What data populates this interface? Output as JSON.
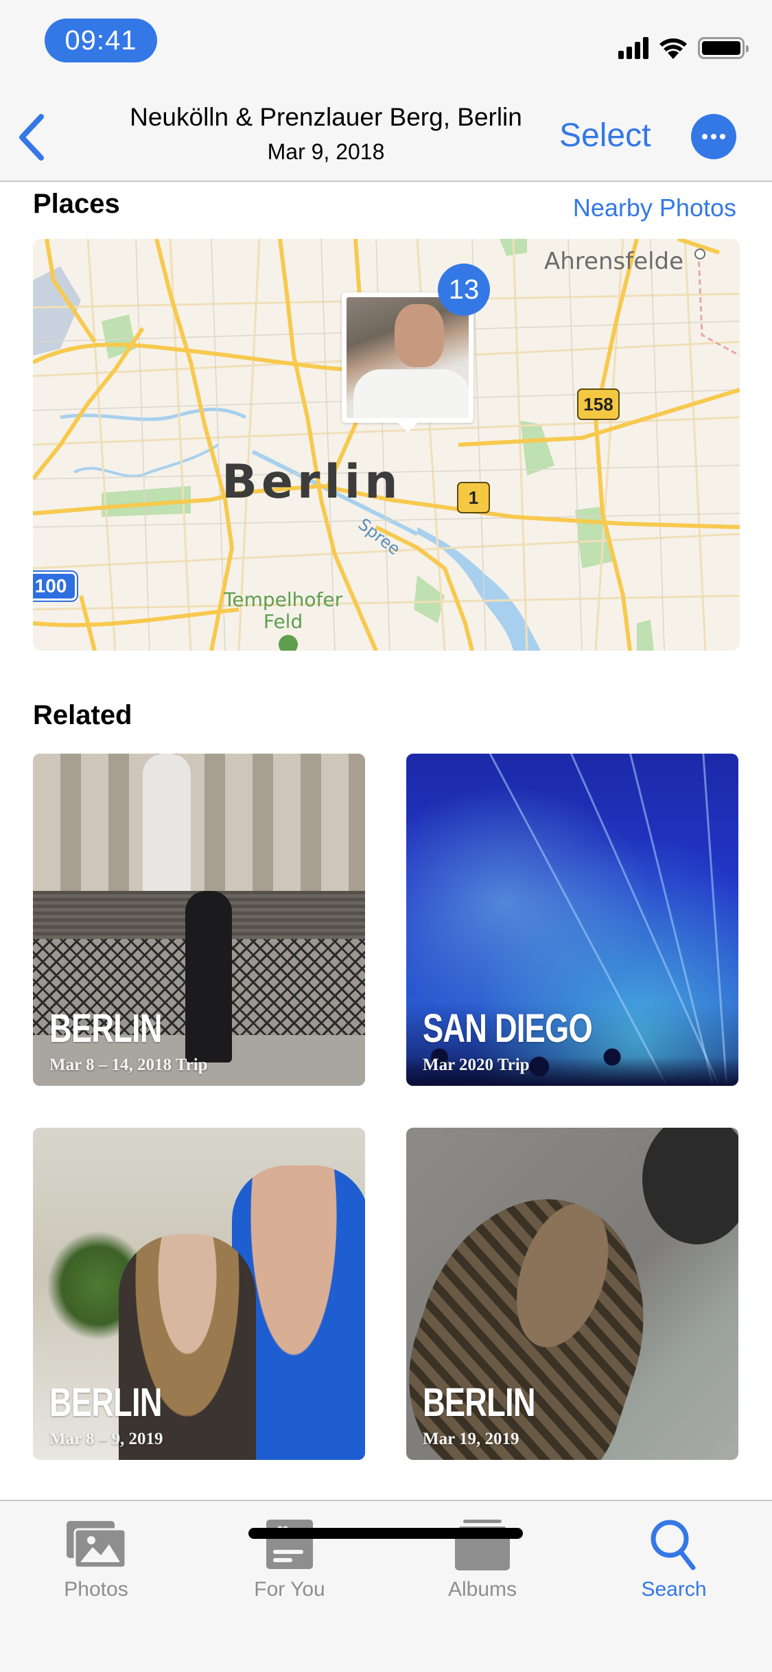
{
  "status_bar": {
    "time": "09:41",
    "icons": [
      "cellular-signal-icon",
      "wifi-icon",
      "battery-icon"
    ]
  },
  "nav": {
    "back_icon": "chevron-left-icon",
    "title": "Neukölln & Prenzlauer Berg, Berlin",
    "subtitle": "Mar 9, 2018",
    "select_label": "Select",
    "more_icon": "ellipsis-circle-icon"
  },
  "places": {
    "title": "Places",
    "nearby_label": "Nearby Photos",
    "map": {
      "city_label": "Berlin",
      "district_label": "Ahrensfelde",
      "park_label_line1": "Tempelhofer",
      "park_label_line2": "Feld",
      "river_label": "Spree",
      "road_shields": [
        "158",
        "1",
        "100"
      ],
      "photo_count": "13"
    }
  },
  "related": {
    "title": "Related",
    "cards": [
      {
        "title": "BERLIN",
        "subtitle": "Mar 8 – 14, 2018 Trip"
      },
      {
        "title": "SAN DIEGO",
        "subtitle": "Mar 2020 Trip"
      },
      {
        "title": "BERLIN",
        "subtitle": "Mar 8 – 9, 2019"
      },
      {
        "title": "BERLIN",
        "subtitle": "Mar 19, 2019"
      }
    ]
  },
  "tab_bar": {
    "tabs": [
      {
        "label": "Photos",
        "icon": "photos-icon",
        "active": false
      },
      {
        "label": "For You",
        "icon": "for-you-icon",
        "active": false
      },
      {
        "label": "Albums",
        "icon": "albums-icon",
        "active": false
      },
      {
        "label": "Search",
        "icon": "search-icon",
        "active": true
      }
    ]
  },
  "colors": {
    "accent": "#3478e6",
    "inactive_tab": "#8e8e8e",
    "bar_background": "#f6f6f6"
  }
}
